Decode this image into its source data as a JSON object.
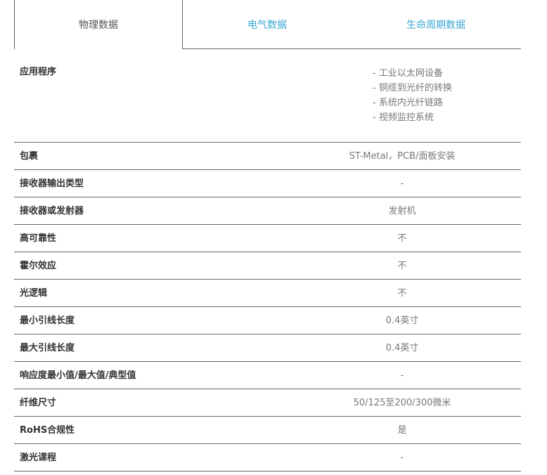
{
  "tabs": [
    {
      "label": "物理数据"
    },
    {
      "label": "电气数据"
    },
    {
      "label": "生命周期数据"
    }
  ],
  "application": {
    "label": "应用程序",
    "items": [
      "- 工业以太网设备",
      "- 铜缆到光纤的转换",
      "- 系统内光纤链路",
      "- 视频监控系统"
    ]
  },
  "rows": [
    {
      "label": "包裹",
      "value": "ST-Metal，PCB/面板安装"
    },
    {
      "label": "接收器输出类型",
      "value": "-"
    },
    {
      "label": "接收器或发射器",
      "value": "发射机"
    },
    {
      "label": "高可靠性",
      "value": "不"
    },
    {
      "label": "霍尔效应",
      "value": "不"
    },
    {
      "label": "光逻辑",
      "value": "不"
    },
    {
      "label": "最小引线长度",
      "value": "0.4英寸"
    },
    {
      "label": "最大引线长度",
      "value": "0.4英寸"
    },
    {
      "label": "响应度最小值/最大值/典型值",
      "value": "-"
    },
    {
      "label": "纤维尺寸",
      "value": "50/125至200/300微米"
    },
    {
      "label": "RoHS合规性",
      "value": "是"
    },
    {
      "label": "激光课程",
      "value": "-"
    }
  ]
}
